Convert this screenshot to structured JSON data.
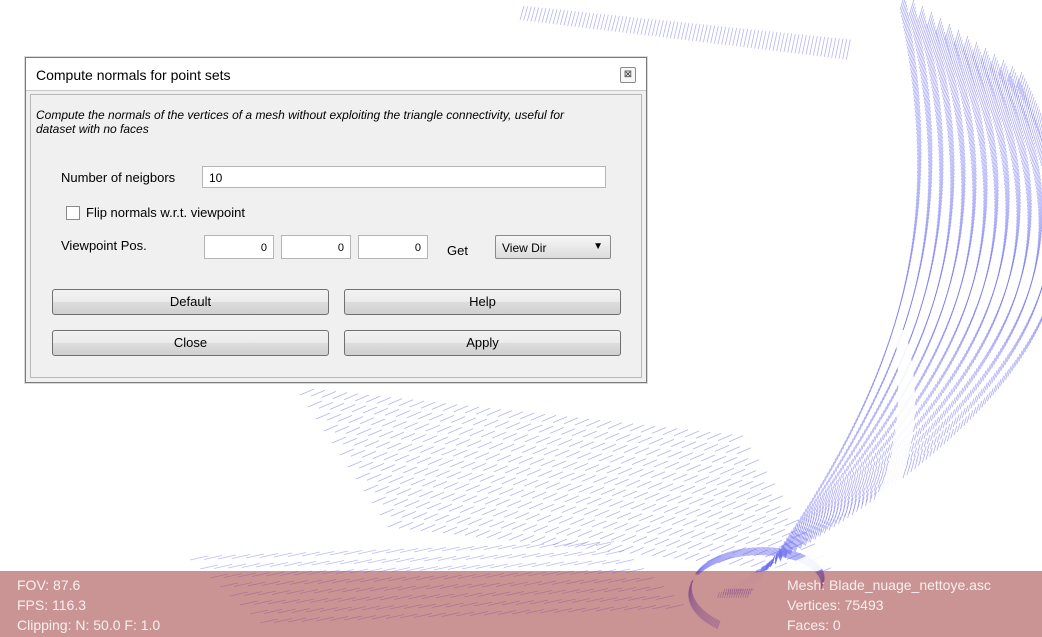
{
  "dialog": {
    "title": "Compute normals for point sets",
    "close_icon": "close-icon",
    "description": "Compute the normals of the vertices of a mesh without exploiting the triangle connectivity, useful for dataset with no faces",
    "neighbors_label": "Number of neigbors",
    "neighbors_value": "10",
    "flip_label": "Flip normals w.r.t. viewpoint",
    "flip_checked": false,
    "viewpoint_label": "Viewpoint Pos.",
    "viewpoint_x": "0",
    "viewpoint_y": "0",
    "viewpoint_z": "0",
    "get_label": "Get",
    "view_dir_selected": "View Dir",
    "buttons": {
      "default": "Default",
      "help": "Help",
      "close": "Close",
      "apply": "Apply"
    }
  },
  "status": {
    "fov": "FOV: 87.6",
    "fps": "FPS:  116.3",
    "clipping": "Clipping: N:  50.0 F:   1.0",
    "mesh": "Mesh: Blade_nuage_nettoye.asc",
    "vertices": "Vertices: 75493",
    "faces": "Faces: 0"
  },
  "colors": {
    "point_cloud": "#6b6bf0",
    "statusbar": "#a03c3c"
  }
}
